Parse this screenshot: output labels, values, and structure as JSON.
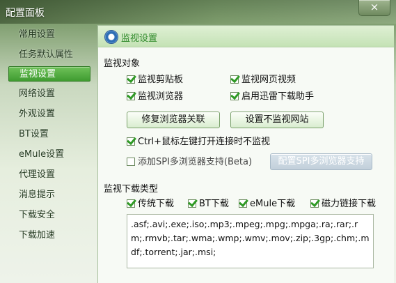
{
  "window": {
    "title": "配置面板",
    "close_label": "×"
  },
  "sidebar": {
    "items": [
      {
        "label": "常用设置"
      },
      {
        "label": "任务默认属性"
      },
      {
        "label": "监视设置",
        "active": true
      },
      {
        "label": "网络设置"
      },
      {
        "label": "外观设置"
      },
      {
        "label": "BT设置"
      },
      {
        "label": "eMule设置"
      },
      {
        "label": "代理设置"
      },
      {
        "label": "消息提示"
      },
      {
        "label": "下载安全"
      },
      {
        "label": "下载加速"
      }
    ]
  },
  "panel": {
    "icon": "eye-icon",
    "title": "监视设置",
    "monitor_objects": {
      "title": "监视对象",
      "options": [
        {
          "label": "监视剪贴板",
          "checked": true
        },
        {
          "label": "监视网页视频",
          "checked": true
        },
        {
          "label": "监视浏览器",
          "checked": true
        },
        {
          "label": "启用迅雷下载助手",
          "checked": true
        }
      ],
      "buttons": {
        "repair": "修复浏览器关联",
        "no_monitor_sites": "设置不监视网站"
      },
      "ctrl_option": {
        "label": "Ctrl+鼠标左键打开连接时不监视",
        "checked": true
      },
      "spi_option": {
        "label": "添加SPI多浏览器支持(Beta)",
        "checked": false
      },
      "spi_button": "配置SPI多浏览器支持"
    },
    "download_types": {
      "title": "监视下载类型",
      "options": [
        {
          "label": "传统下载",
          "checked": true
        },
        {
          "label": "BT下载",
          "checked": true
        },
        {
          "label": "eMule下载",
          "checked": true
        },
        {
          "label": "磁力链接下载",
          "checked": true
        }
      ],
      "extensions": ".asf;.avi;.exe;.iso;.mp3;.mpeg;.mpg;.mpga;.ra;.rar;.rm;.rmvb;.tar;.wma;.wmp;.wmv;.mov;.zip;.3gp;.chm;.mdf;.torrent;.jar;.msi;"
    }
  },
  "colors": {
    "accent_green": "#3f9b30",
    "header_title": "#2f8a2a"
  }
}
